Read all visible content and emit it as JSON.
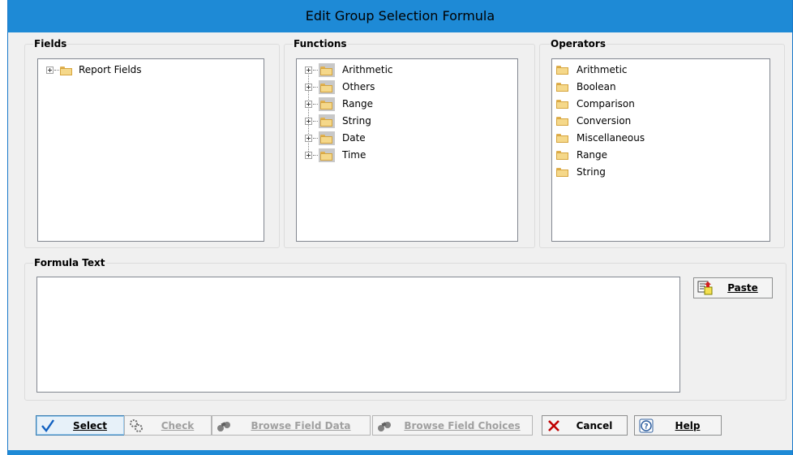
{
  "window": {
    "title": "Edit Group Selection Formula"
  },
  "fields": {
    "label": "Fields",
    "items": [
      {
        "label": "Report Fields"
      }
    ]
  },
  "functions": {
    "label": "Functions",
    "items": [
      {
        "label": "Arithmetic"
      },
      {
        "label": "Others"
      },
      {
        "label": "Range"
      },
      {
        "label": "String"
      },
      {
        "label": "Date"
      },
      {
        "label": "Time"
      }
    ]
  },
  "operators": {
    "label": "Operators",
    "items": [
      {
        "label": "Arithmetic"
      },
      {
        "label": "Boolean"
      },
      {
        "label": "Comparison"
      },
      {
        "label": "Conversion"
      },
      {
        "label": "Miscellaneous"
      },
      {
        "label": "Range"
      },
      {
        "label": "String"
      }
    ]
  },
  "formula": {
    "label": "Formula Text",
    "value": ""
  },
  "buttons": {
    "paste": {
      "label": "Paste",
      "icon": "paste-icon"
    },
    "select": {
      "label": "Select",
      "icon": "checkmark-icon"
    },
    "check": {
      "label": "Check",
      "icon": "gears-icon"
    },
    "browse_data": {
      "label": "Browse Field Data",
      "icon": "binoculars-icon"
    },
    "browse_choices": {
      "label": "Browse Field Choices",
      "icon": "binoculars-icon"
    },
    "cancel": {
      "label": "Cancel",
      "icon": "x-icon"
    },
    "help": {
      "label": "Help",
      "icon": "help-icon"
    }
  },
  "colors": {
    "titlebar": "#1e8ad6",
    "dialog_bg": "#f0f0f0",
    "cancel_x": "#c00000",
    "select_check": "#1060c0"
  }
}
